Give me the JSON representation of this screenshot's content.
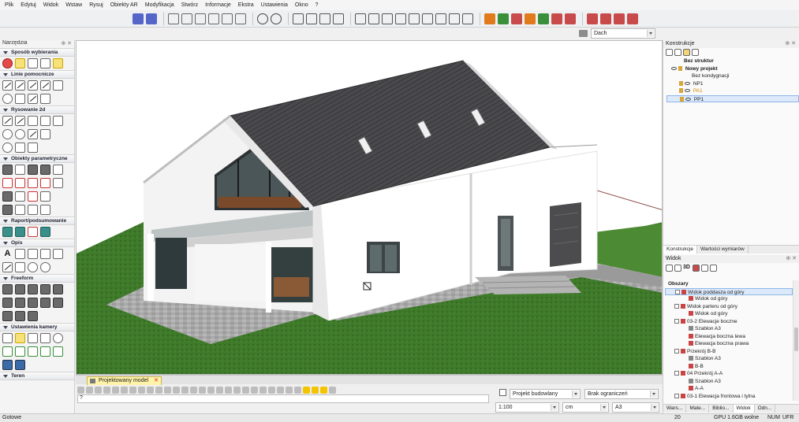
{
  "menu": [
    "Plik",
    "Edytuj",
    "Widok",
    "Wstaw",
    "Rysuj",
    "Obiekty AR",
    "Modyfikacja",
    "Stwórz",
    "Informacje",
    "Ekstra",
    "Ustawienia",
    "Okno",
    "?"
  ],
  "layer_select": "Dach",
  "left": {
    "title": "Narzędzia",
    "sections": {
      "s1": "Sposób wybierania",
      "s2": "Linie pomocnicze",
      "s3": "Rysowanie 2d",
      "s4": "Obiekty parametryczne",
      "s5": "Raport/podsumowanie",
      "s6": "Opis",
      "s7": "Freeform",
      "s8": "Ustawienia kamery",
      "s9": "Teren"
    }
  },
  "tab": {
    "label": "Projektowany model"
  },
  "bottom": {
    "project_select": "Projekt budowlany",
    "limit_select": "Brak ograniczeń",
    "scale_select": "1:100",
    "unit_select": "cm",
    "paper_select": "A3"
  },
  "status": {
    "left": "Gotowe",
    "count": "20",
    "gpu": "GPU 1.6GB wolne",
    "num": "NUM",
    "ufr": "UFR"
  },
  "right": {
    "konstrukcje_title": "Konstrukcje",
    "tree": [
      {
        "label": "Bez struktur"
      },
      {
        "label": "Nowy projekt"
      },
      {
        "label": "Bez kondygnacji"
      },
      {
        "label": "NP1"
      },
      {
        "label": "PA1"
      },
      {
        "label": "PP1"
      }
    ],
    "tabs1": [
      "Konstrukcje",
      "Wartości wymiarów"
    ],
    "widok_title": "Widok",
    "view_header": "Obszary",
    "view_tree": [
      "Widok poddasza od góry",
      "Widok od góry",
      "Widok parteru od góry",
      "Widok od góry",
      "03-2 Elewacje boczne",
      "Szablon A3",
      "Elewacja boczna lewa",
      "Elewacja boczna prawa",
      "Przekrój B-B",
      "Szablon A3",
      "B-B",
      "04 Przekrój A-A",
      "Szablon A3",
      "A-A",
      "03-1 Elewacja frontowa i tylna"
    ],
    "tabs2": [
      "Wars...",
      "Mate...",
      "Biblio...",
      "Widok",
      "Odn..."
    ]
  },
  "colors": {
    "accent": "#f5c400",
    "grass": "#3f7a2a",
    "roof": "#4a4a4d",
    "selection": "#dbe9fb"
  }
}
